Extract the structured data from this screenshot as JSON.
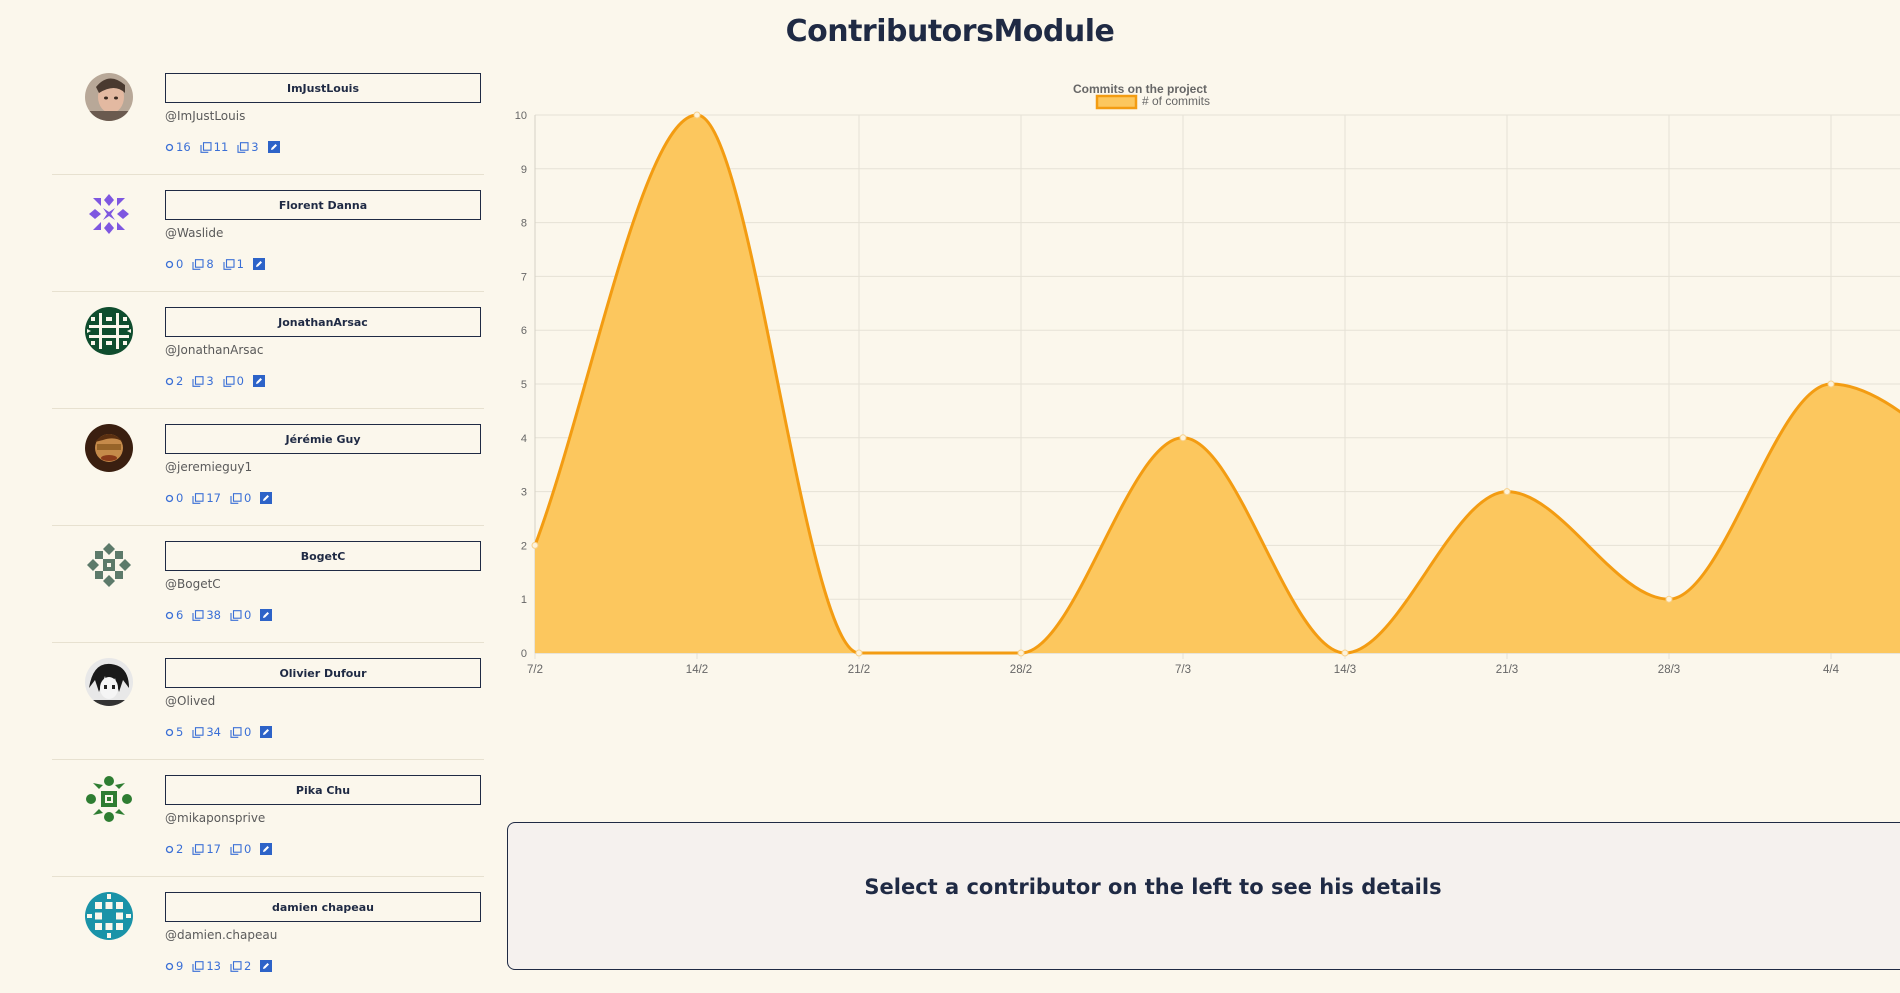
{
  "page": {
    "title": "ContributorsModule"
  },
  "contributors": [
    {
      "name": "ImJustLouis",
      "handle": "@ImJustLouis",
      "stats": [
        "16",
        "11",
        "3"
      ],
      "avatar": "photo-man"
    },
    {
      "name": "Florent Danna",
      "handle": "@Waslide",
      "stats": [
        "0",
        "8",
        "1"
      ],
      "avatar": "identicon-purple"
    },
    {
      "name": "JonathanArsac",
      "handle": "@JonathanArsac",
      "stats": [
        "2",
        "3",
        "0"
      ],
      "avatar": "identicon-darkgreen"
    },
    {
      "name": "Jérémie Guy",
      "handle": "@jeremieguy1",
      "stats": [
        "0",
        "17",
        "0"
      ],
      "avatar": "photo-dark"
    },
    {
      "name": "BogetC",
      "handle": "@BogetC",
      "stats": [
        "6",
        "38",
        "0"
      ],
      "avatar": "identicon-grey-green"
    },
    {
      "name": "Olivier Dufour",
      "handle": "@Olived",
      "stats": [
        "5",
        "34",
        "0"
      ],
      "avatar": "photo-anime"
    },
    {
      "name": "Pika Chu",
      "handle": "@mikaponsprive",
      "stats": [
        "2",
        "17",
        "0"
      ],
      "avatar": "identicon-green"
    },
    {
      "name": "damien chapeau",
      "handle": "@damien.chapeau",
      "stats": [
        "9",
        "13",
        "2"
      ],
      "avatar": "identicon-teal"
    }
  ],
  "colors": {
    "fill": "#fcc75e",
    "line": "#f39c12",
    "link": "#3a6fd6",
    "text": "#1f2a44",
    "purple": "#7e57e0",
    "darkgreen": "#0f4d2e",
    "greygreen": "#5c7a6a",
    "green": "#2e7d32",
    "teal": "#1a93a8"
  },
  "chart_data": {
    "type": "area",
    "title": "Commits on the project",
    "legend": [
      "# of commits"
    ],
    "legend_position": "top-center",
    "grid": true,
    "x": [
      "7/2",
      "14/2",
      "21/2",
      "28/2",
      "7/3",
      "14/3",
      "21/3",
      "28/3",
      "4/4"
    ],
    "series": [
      {
        "name": "# of commits",
        "values": [
          2,
          10,
          0,
          0,
          4,
          0,
          3,
          1,
          5
        ]
      }
    ],
    "x_visible_end_value": 3.2,
    "ylim": [
      0,
      10
    ],
    "yticks": [
      0,
      1,
      2,
      3,
      4,
      5,
      6,
      7,
      8,
      9,
      10
    ]
  },
  "details": {
    "placeholder": "Select a contributor on the left to see his details"
  }
}
